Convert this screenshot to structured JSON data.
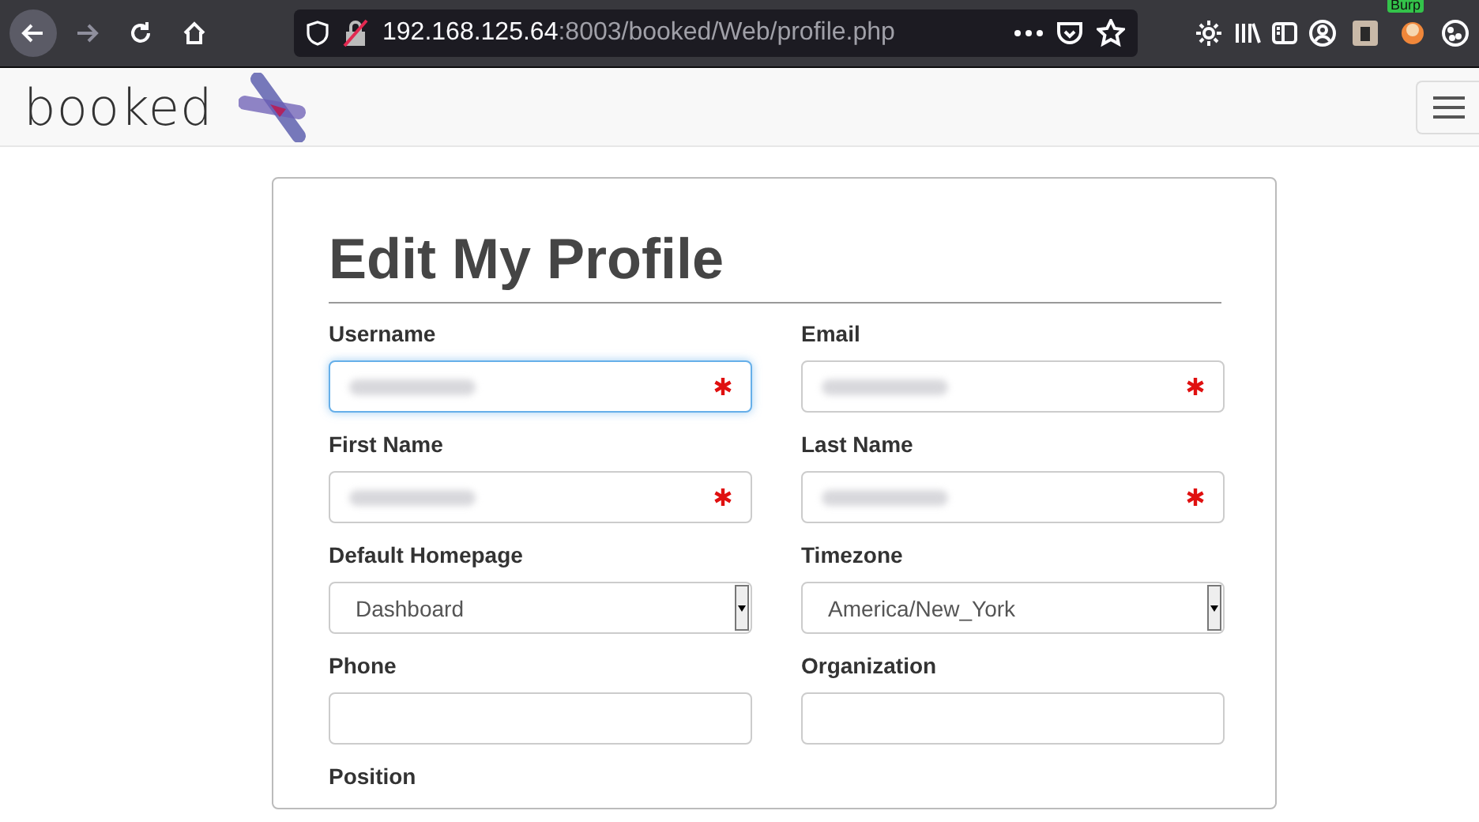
{
  "browser": {
    "url_host": "192.168.125.64",
    "url_rest": ":8003/booked/Web/profile.php",
    "extension_badge": "Burp"
  },
  "app": {
    "logo": "booked"
  },
  "form": {
    "title": "Edit My Profile",
    "fields": [
      {
        "label": "Username",
        "kind": "text",
        "required": true,
        "redacted": true,
        "focused": true
      },
      {
        "label": "Email",
        "kind": "text",
        "required": true,
        "redacted": true,
        "focused": false
      },
      {
        "label": "First Name",
        "kind": "text",
        "required": true,
        "redacted": true,
        "focused": false
      },
      {
        "label": "Last Name",
        "kind": "text",
        "required": true,
        "redacted": true,
        "focused": false
      },
      {
        "label": "Default Homepage",
        "kind": "select",
        "value": "Dashboard"
      },
      {
        "label": "Timezone",
        "kind": "select",
        "value": "America/New_York"
      },
      {
        "label": "Phone",
        "kind": "text",
        "required": false,
        "redacted": false,
        "focused": false
      },
      {
        "label": "Organization",
        "kind": "text",
        "required": false,
        "redacted": false,
        "focused": false
      },
      {
        "label": "Position",
        "kind": "label_only"
      }
    ]
  }
}
